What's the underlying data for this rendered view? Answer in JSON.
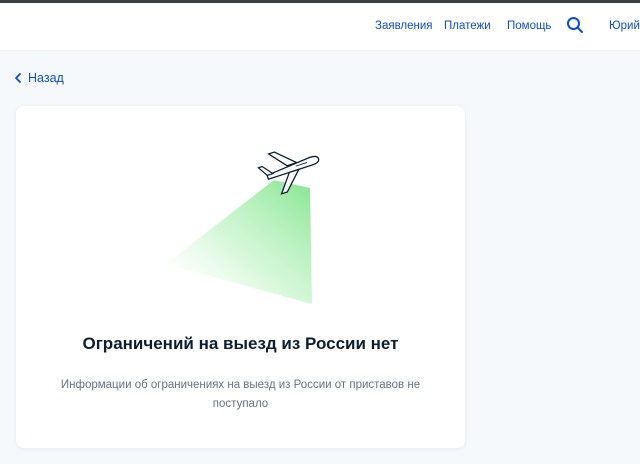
{
  "header": {
    "nav": [
      {
        "label": "Заявления"
      },
      {
        "label": "Платежи"
      },
      {
        "label": "Помощь"
      }
    ],
    "search_icon": "search-icon",
    "user_name": "Юрий"
  },
  "back": {
    "label": "Назад",
    "icon": "chevron-left-icon"
  },
  "card": {
    "illustration": "airplane-icon",
    "title": "Ограничений на выезд из России нет",
    "description": "Информации об ограничениях на выезд из России от приставов не поступало"
  },
  "colors": {
    "link": "#0d4cd3",
    "title": "#0b1f33",
    "text_secondary": "#66727f",
    "background": "#f6f9fc",
    "accent_green": "#7ee38a"
  }
}
